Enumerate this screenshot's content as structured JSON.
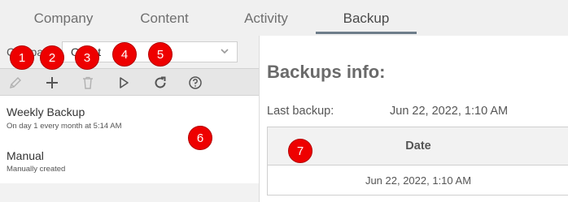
{
  "tabs": [
    {
      "label": "Company"
    },
    {
      "label": "Content"
    },
    {
      "label": "Activity"
    },
    {
      "label": "Backup",
      "active": true
    }
  ],
  "left": {
    "company_label": "Company:",
    "company_value": "Offset",
    "toolbar": {
      "edit": "pencil-icon",
      "add": "plus-icon",
      "delete": "trash-icon",
      "run": "play-icon",
      "refresh": "refresh-icon",
      "help": "help-icon"
    },
    "list": [
      {
        "title": "Weekly Backup",
        "subtitle": "On day 1 every month at 5:14 AM"
      },
      {
        "title": "Manual",
        "subtitle": "Manually created"
      }
    ]
  },
  "right": {
    "title": "Backups info:",
    "last_backup_label": "Last backup:",
    "last_backup_value": "Jun 22, 2022, 1:10 AM",
    "table": {
      "header": "Date",
      "rows": [
        "Jun 22, 2022, 1:10 AM"
      ]
    }
  },
  "markers": [
    "1",
    "2",
    "3",
    "4",
    "5",
    "6",
    "7"
  ],
  "colors": {
    "marker": "#ee0000",
    "tab_underline": "#6e7d8a",
    "tab_bar": "#f0f0f0"
  }
}
